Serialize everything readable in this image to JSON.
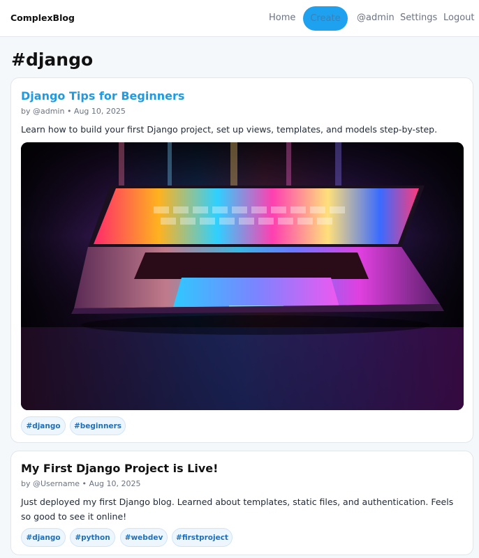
{
  "nav": {
    "brand": "ComplexBlog",
    "home": "Home",
    "create": "Create",
    "user": "@admin",
    "settings": "Settings",
    "logout": "Logout"
  },
  "page": {
    "title": "#django"
  },
  "posts": [
    {
      "title": "Django Tips for Beginners",
      "meta": "by @admin • Aug 10, 2025",
      "excerpt": "Learn how to build your first Django project, set up views, templates, and models step-by-step.",
      "image": "laptop-photo",
      "tags": [
        "#django",
        "#beginners"
      ]
    },
    {
      "title": "My First Django Project is Live!",
      "meta": "by @Username • Aug 10, 2025",
      "excerpt": "Just deployed my first Django blog. Learned about templates, static files, and authentication. Feels so good to see it online!",
      "tags": [
        "#django",
        "#python",
        "#webdev",
        "#firstproject"
      ]
    }
  ],
  "colors": {
    "accent": "#1ea1ee",
    "link": "#1e9be4",
    "tag_text": "#1f6fb8"
  }
}
